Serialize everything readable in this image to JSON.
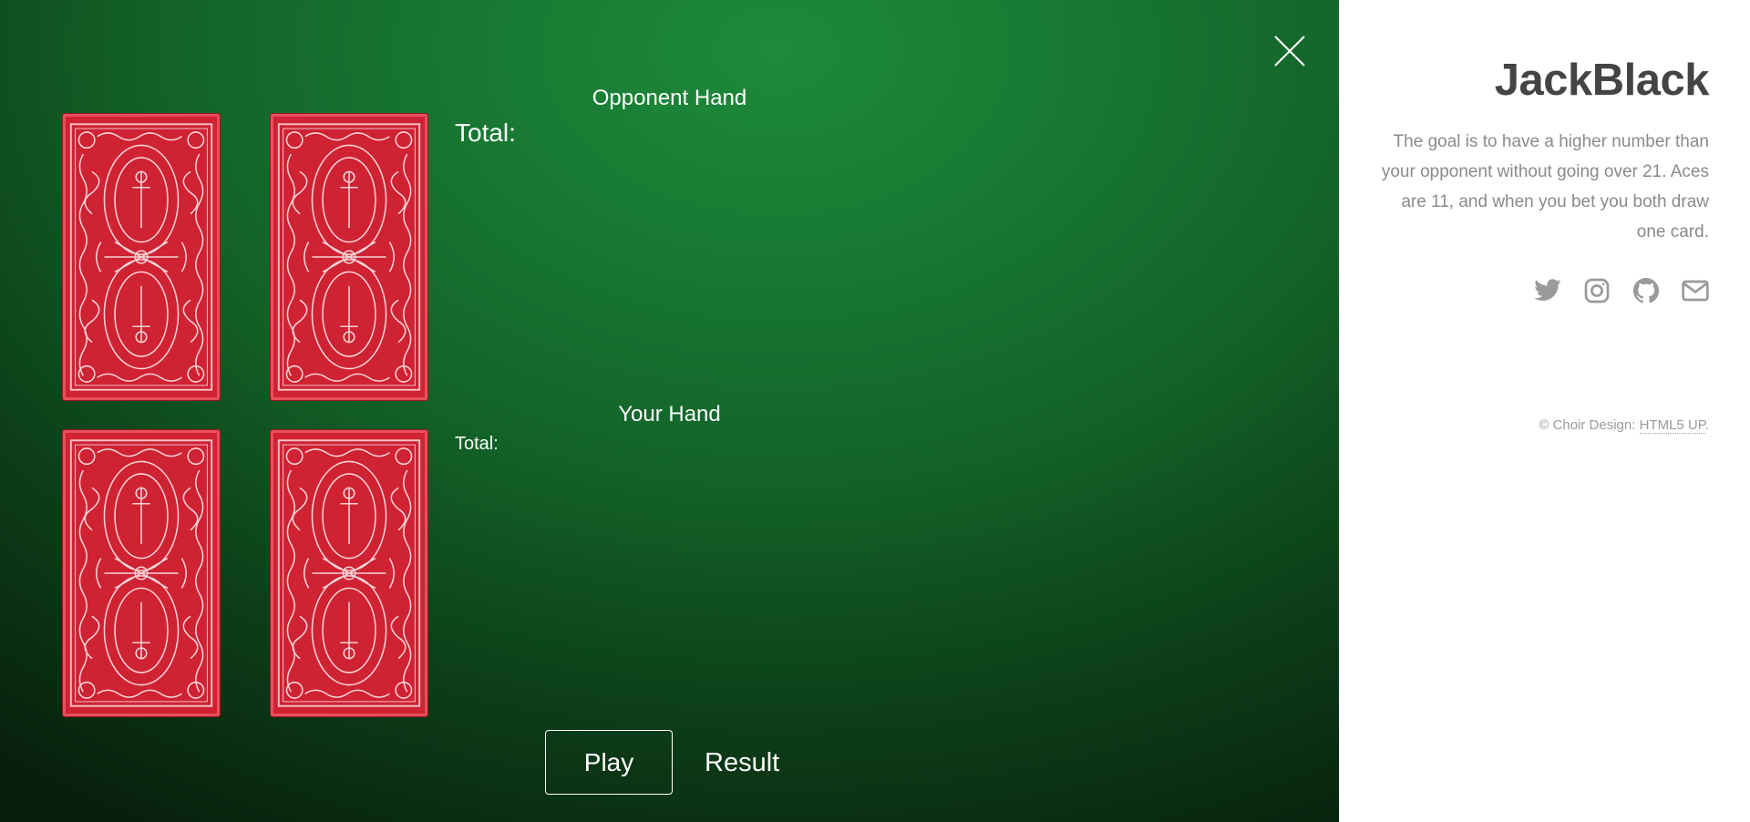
{
  "game": {
    "opponent_hand_title": "Opponent Hand",
    "opponent_total_label": "Total:",
    "your_hand_title": "Your Hand",
    "your_total_label": "Total:",
    "play_label": "Play",
    "result_label": "Result",
    "close_icon": "close-icon",
    "card_back_icon": "card-back-icon",
    "table_color": "#187a33",
    "card_color": "#cf2233"
  },
  "sidebar": {
    "title": "JackBlack",
    "description": "The goal is to have a higher number than your opponent without going over 21. Aces are 11, and when you bet you both draw one card.",
    "social_icons": [
      "twitter-icon",
      "instagram-icon",
      "github-icon",
      "envelope-icon"
    ],
    "copyright_prefix": "© Choir Design:",
    "copyright_link": "HTML5 UP",
    "copyright_suffix": "."
  }
}
